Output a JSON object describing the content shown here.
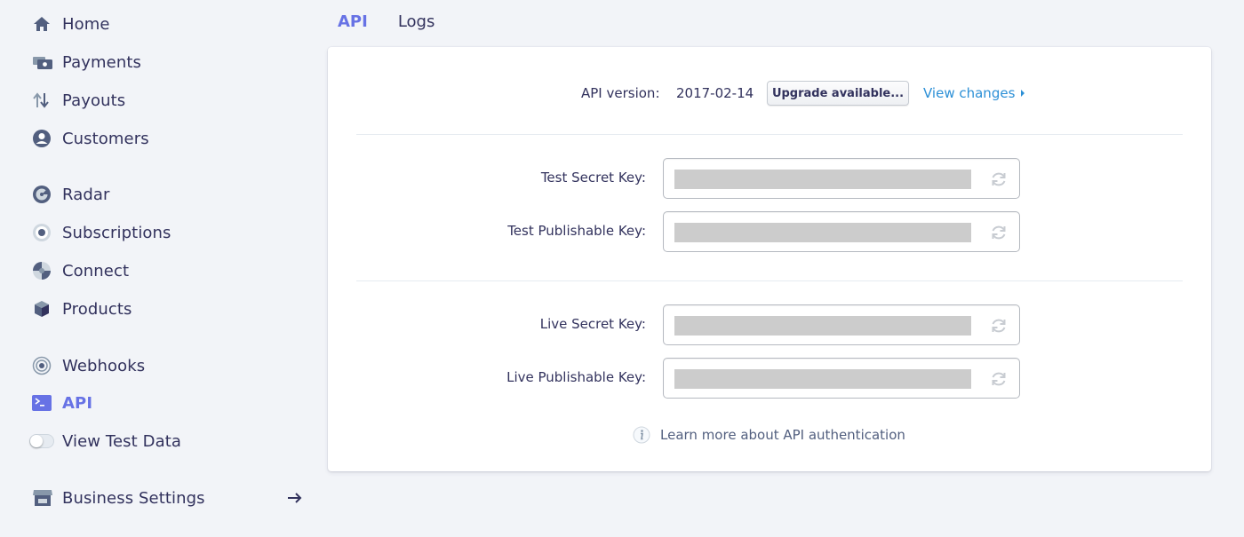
{
  "sidebar": {
    "items": [
      {
        "label": "Home",
        "icon": "home-icon"
      },
      {
        "label": "Payments",
        "icon": "payments-icon"
      },
      {
        "label": "Payouts",
        "icon": "payouts-icon"
      },
      {
        "label": "Customers",
        "icon": "customers-icon"
      },
      {
        "label": "Radar",
        "icon": "radar-icon"
      },
      {
        "label": "Subscriptions",
        "icon": "subscriptions-icon"
      },
      {
        "label": "Connect",
        "icon": "connect-icon"
      },
      {
        "label": "Products",
        "icon": "products-icon"
      },
      {
        "label": "Webhooks",
        "icon": "webhooks-icon"
      },
      {
        "label": "API",
        "icon": "api-icon",
        "active": true
      },
      {
        "label": "View Test Data",
        "icon": "toggle-switch",
        "toggle_on": false
      },
      {
        "label": "Business Settings",
        "icon": "business-settings-icon"
      }
    ]
  },
  "tabs": [
    {
      "label": "API",
      "active": true
    },
    {
      "label": "Logs",
      "active": false
    }
  ],
  "api_card": {
    "version_label": "API version:",
    "version_value": "2017-02-14",
    "upgrade_button": "Upgrade available...",
    "view_changes_link": "View changes",
    "keys": [
      {
        "label": "Test Secret Key:",
        "value": ""
      },
      {
        "label": "Test Publishable Key:",
        "value": ""
      },
      {
        "label": "Live Secret Key:",
        "value": ""
      },
      {
        "label": "Live Publishable Key:",
        "value": ""
      }
    ],
    "learn_more": "Learn more about API authentication"
  },
  "colors": {
    "accent": "#6772e5",
    "link": "#2b8fd6",
    "text": "#32325d",
    "background": "#f2f4f8",
    "mask": "#cccccc"
  }
}
